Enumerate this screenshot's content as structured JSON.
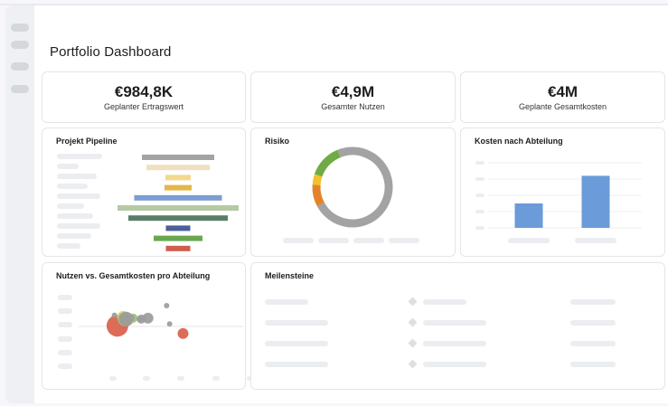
{
  "page": {
    "title": "Portfolio Dashboard"
  },
  "kpis": [
    {
      "value": "€984,8K",
      "label": "Geplanter Ertragswert"
    },
    {
      "value": "€4,9M",
      "label": "Gesamter Nutzen"
    },
    {
      "value": "€4M",
      "label": "Geplante Gesamtkosten"
    }
  ],
  "cards": {
    "pipeline": {
      "title": "Projekt Pipeline"
    },
    "risk": {
      "title": "Risiko"
    },
    "costs": {
      "title": "Kosten nach Abteilung"
    },
    "scatter": {
      "title": "Nutzen vs. Gesamtkosten pro Abteilung"
    },
    "milestones": {
      "title": "Meilensteine"
    }
  },
  "chart_data": [
    {
      "type": "bar",
      "title": "Projekt Pipeline",
      "orientation": "horizontal-funnel",
      "categories": [
        "",
        "",
        "",
        "",
        "",
        "",
        "",
        "",
        "",
        ""
      ],
      "values": [
        80,
        70,
        28,
        30,
        97,
        134,
        110,
        27,
        54,
        27
      ],
      "colors": [
        "#a3a3a3",
        "#f0dfc0",
        "#f2d98c",
        "#e3b84a",
        "#7b9dcf",
        "#b5c9a4",
        "#5a7d68",
        "#4b5f99",
        "#6aa84f",
        "#d05e4a"
      ],
      "xlim": [
        0,
        140
      ]
    },
    {
      "type": "pie",
      "title": "Risiko",
      "style": "donut",
      "values": [
        73.2,
        8.9,
        4.3,
        13.6
      ],
      "colors": [
        "#a3a3a3",
        "#e3842a",
        "#f2c12e",
        "#70ab45"
      ]
    },
    {
      "type": "bar",
      "title": "Kosten nach Abteilung",
      "categories": [
        "",
        ""
      ],
      "values": [
        30,
        64
      ],
      "ylim": [
        0,
        80
      ],
      "colors": [
        "#6b9bd8",
        "#6b9bd8"
      ],
      "grid": true
    },
    {
      "type": "scatter",
      "title": "Nutzen vs. Gesamtkosten pro Abteilung",
      "points": [
        {
          "x": 5.2,
          "y": 4.3,
          "size": 12,
          "color": "#d9604a"
        },
        {
          "x": 6.0,
          "y": 5.2,
          "size": 7,
          "color": "#e8d27a"
        },
        {
          "x": 6.2,
          "y": 5.0,
          "size": 8,
          "color": "#9ebd78"
        },
        {
          "x": 6.4,
          "y": 5.0,
          "size": 8,
          "color": "#9b9b9b"
        },
        {
          "x": 7.3,
          "y": 5.1,
          "size": 5,
          "color": "#9ebd78"
        },
        {
          "x": 7.0,
          "y": 5.1,
          "size": 4,
          "color": "#9b9b9b"
        },
        {
          "x": 8.4,
          "y": 5.0,
          "size": 5,
          "color": "#9b9b9b"
        },
        {
          "x": 9.3,
          "y": 5.1,
          "size": 6,
          "color": "#9b9b9b"
        },
        {
          "x": 4.8,
          "y": 5.4,
          "size": 3,
          "color": "#9b9b9b"
        },
        {
          "x": 8.2,
          "y": 5.0,
          "size": 3,
          "color": "#9b9b9b"
        },
        {
          "x": 11.8,
          "y": 6.4,
          "size": 3,
          "color": "#9b9b9b"
        },
        {
          "x": 12.2,
          "y": 4.5,
          "size": 3,
          "color": "#9b9b9b"
        },
        {
          "x": 14.0,
          "y": 3.5,
          "size": 6,
          "color": "#d9604a"
        }
      ],
      "xlim": [
        0,
        20
      ],
      "ylim": [
        0,
        8
      ]
    }
  ]
}
